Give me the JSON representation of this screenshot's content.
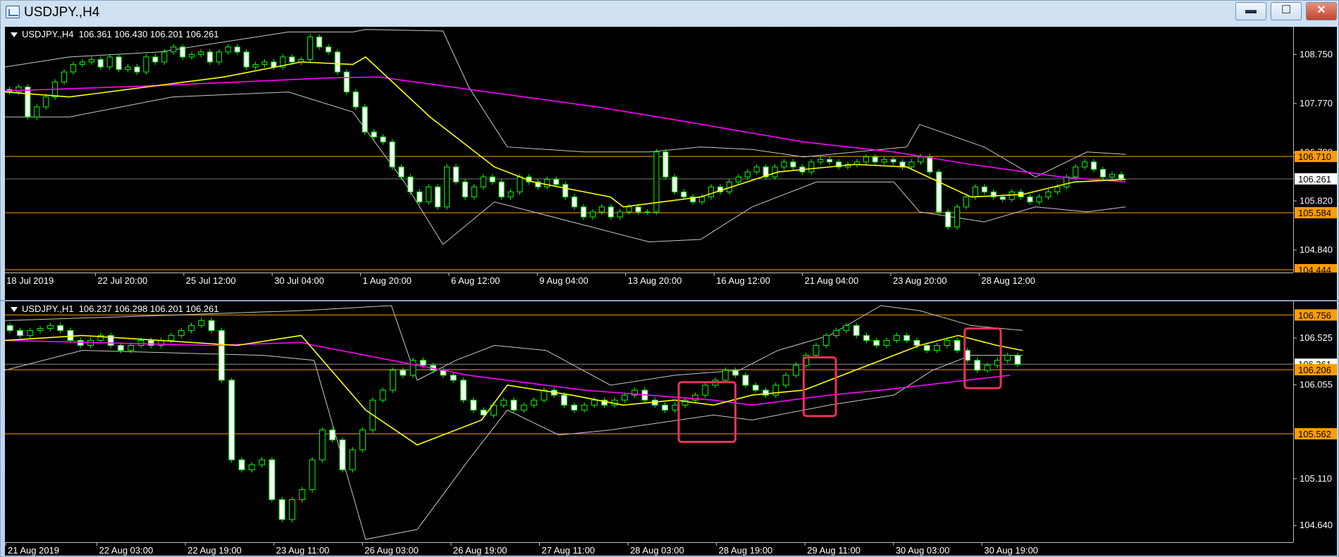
{
  "window": {
    "title": "USDJPY.,H4"
  },
  "controls": {
    "minimize": "▬",
    "maximize": "☐",
    "close": "✕"
  },
  "colors": {
    "background": "#000000",
    "bull": "#00ff00",
    "bear": "#ffffff",
    "ma_fast": "#ffff00",
    "ma_slow": "#ff00ff",
    "bands": "#c8c8c8",
    "level": "#ff9c00",
    "highlight": "#e8335a",
    "axis_text": "#ffffff"
  },
  "chart_data": [
    {
      "type": "candlestick",
      "name": "USDJPY.,H4",
      "info_symbol": "USDJPY.,H4",
      "info_ohlc": "106.361 106.430 106.201 106.261",
      "ylim": [
        104.444,
        109.22
      ],
      "y_ticks": [
        108.75,
        107.77,
        106.79,
        105.82,
        104.84
      ],
      "y_tick_labels": [
        "108.750",
        "107.770",
        "106.790",
        "105.820",
        "104.840"
      ],
      "x_tick_labels": [
        "18 Jul 2019",
        "22 Jul 20:00",
        "25 Jul 12:00",
        "30 Jul 04:00",
        "1 Aug 20:00",
        "6 Aug 12:00",
        "9 Aug 04:00",
        "13 Aug 20:00",
        "16 Aug 12:00",
        "21 Aug 04:00",
        "23 Aug 20:00",
        "28 Aug 12:00"
      ],
      "levels": [
        {
          "value": 106.71,
          "label": "106.710",
          "color": "#ff9c00",
          "style": "orange"
        },
        {
          "value": 106.261,
          "label": "106.261",
          "color": "#a0a0a0",
          "style": "price"
        },
        {
          "value": 105.584,
          "label": "105.584",
          "color": "#ff9c00",
          "style": "orange"
        },
        {
          "value": 104.444,
          "label": "104.444",
          "color": "#ff9c00",
          "style": "orange"
        }
      ],
      "close_path": [
        108.0,
        108.1,
        107.5,
        107.7,
        107.9,
        108.2,
        108.4,
        108.55,
        108.6,
        108.65,
        108.5,
        108.7,
        108.45,
        108.5,
        108.4,
        108.7,
        108.6,
        108.8,
        108.9,
        108.7,
        108.75,
        108.8,
        108.6,
        108.8,
        108.9,
        108.8,
        108.5,
        108.55,
        108.6,
        108.5,
        108.7,
        108.6,
        108.65,
        109.1,
        108.9,
        108.8,
        108.4,
        108.0,
        107.7,
        107.2,
        107.1,
        107.0,
        106.5,
        106.3,
        106.0,
        105.8,
        106.1,
        105.7,
        106.5,
        106.2,
        105.9,
        106.1,
        106.3,
        106.2,
        105.9,
        106.0,
        106.3,
        106.2,
        106.1,
        106.25,
        106.15,
        105.9,
        105.7,
        105.5,
        105.6,
        105.7,
        105.5,
        105.6,
        105.7,
        105.6,
        105.6,
        106.8,
        106.3,
        106.0,
        105.9,
        105.8,
        105.9,
        106.1,
        106.0,
        106.2,
        106.3,
        106.4,
        106.5,
        106.3,
        106.5,
        106.6,
        106.5,
        106.4,
        106.6,
        106.65,
        106.6,
        106.5,
        106.55,
        106.6,
        106.7,
        106.6,
        106.65,
        106.6,
        106.5,
        106.6,
        106.7,
        106.4,
        105.6,
        105.3,
        105.7,
        105.9,
        106.1,
        106.0,
        105.9,
        105.85,
        106.0,
        105.9,
        105.8,
        105.9,
        106.0,
        106.1,
        106.3,
        106.5,
        106.6,
        106.45,
        106.3,
        106.35,
        106.26
      ],
      "ma_slow_points": [
        [
          108.02,
          0
        ],
        [
          108.13,
          0.12
        ],
        [
          108.28,
          0.25
        ],
        [
          108.3,
          0.29
        ],
        [
          107.7,
          0.46
        ],
        [
          107.4,
          0.53
        ],
        [
          107.0,
          0.62
        ],
        [
          106.8,
          0.69
        ],
        [
          106.55,
          0.75
        ],
        [
          106.3,
          0.82
        ],
        [
          106.2,
          0.87
        ]
      ],
      "ma_fast_points": [
        [
          108.0,
          0
        ],
        [
          107.9,
          0.05
        ],
        [
          108.1,
          0.11
        ],
        [
          108.3,
          0.17
        ],
        [
          108.6,
          0.23
        ],
        [
          108.55,
          0.27
        ],
        [
          108.7,
          0.28
        ],
        [
          107.5,
          0.33
        ],
        [
          106.5,
          0.38
        ],
        [
          106.2,
          0.41
        ],
        [
          105.9,
          0.47
        ],
        [
          105.7,
          0.48
        ],
        [
          105.9,
          0.54
        ],
        [
          106.4,
          0.6
        ],
        [
          106.55,
          0.66
        ],
        [
          106.5,
          0.7
        ],
        [
          105.9,
          0.75
        ],
        [
          105.95,
          0.79
        ],
        [
          106.2,
          0.83
        ],
        [
          106.25,
          0.87
        ]
      ],
      "band_upper_points": [
        [
          108.5,
          0
        ],
        [
          108.7,
          0.05
        ],
        [
          108.8,
          0.12
        ],
        [
          109.2,
          0.22
        ],
        [
          109.2,
          0.27
        ],
        [
          109.25,
          0.28
        ],
        [
          109.22,
          0.34
        ],
        [
          108.1,
          0.36
        ],
        [
          106.9,
          0.39
        ],
        [
          106.8,
          0.45
        ],
        [
          106.8,
          0.5
        ],
        [
          106.9,
          0.54
        ],
        [
          106.85,
          0.58
        ],
        [
          106.7,
          0.62
        ],
        [
          106.9,
          0.7
        ],
        [
          107.35,
          0.71
        ],
        [
          106.9,
          0.76
        ],
        [
          106.3,
          0.8
        ],
        [
          106.8,
          0.84
        ],
        [
          106.75,
          0.87
        ]
      ],
      "band_lower_points": [
        [
          107.5,
          0
        ],
        [
          107.5,
          0.05
        ],
        [
          107.9,
          0.13
        ],
        [
          108.0,
          0.22
        ],
        [
          107.6,
          0.27
        ],
        [
          106.2,
          0.31
        ],
        [
          104.95,
          0.34
        ],
        [
          105.8,
          0.38
        ],
        [
          105.6,
          0.41
        ],
        [
          105.0,
          0.5
        ],
        [
          105.05,
          0.54
        ],
        [
          105.7,
          0.58
        ],
        [
          106.2,
          0.63
        ],
        [
          106.2,
          0.69
        ],
        [
          105.6,
          0.71
        ],
        [
          105.4,
          0.76
        ],
        [
          105.7,
          0.8
        ],
        [
          105.6,
          0.84
        ],
        [
          105.7,
          0.87
        ]
      ]
    },
    {
      "type": "candlestick",
      "name": "USDJPY.,H1",
      "info_symbol": "USDJPY.,H1",
      "info_ohlc": "106.237 106.298 106.201 106.261",
      "ylim": [
        104.5,
        106.85
      ],
      "y_ticks": [
        106.525,
        106.055,
        105.11,
        104.64
      ],
      "y_tick_labels": [
        "106.525",
        "106.055",
        "105.110",
        "104.640"
      ],
      "x_tick_labels": [
        "21 Aug 2019",
        "22 Aug 03:00",
        "22 Aug 19:00",
        "23 Aug 11:00",
        "26 Aug 03:00",
        "26 Aug 19:00",
        "27 Aug 11:00",
        "28 Aug 03:00",
        "28 Aug 19:00",
        "29 Aug 11:00",
        "30 Aug 03:00",
        "30 Aug 19:00"
      ],
      "levels": [
        {
          "value": 106.756,
          "label": "106.756",
          "color": "#ff9c00",
          "style": "orange"
        },
        {
          "value": 106.261,
          "label": "106.261",
          "color": "#a0a0a0",
          "style": "price"
        },
        {
          "value": 106.206,
          "label": "106.206",
          "color": "#ff9c00",
          "style": "orange"
        },
        {
          "value": 105.562,
          "label": "105.562",
          "color": "#ff9c00",
          "style": "orange"
        }
      ],
      "close_path": [
        106.6,
        106.55,
        106.6,
        106.62,
        106.65,
        106.6,
        106.5,
        106.45,
        106.5,
        106.55,
        106.45,
        106.4,
        106.45,
        106.5,
        106.45,
        106.5,
        106.55,
        106.6,
        106.65,
        106.7,
        106.6,
        106.1,
        105.3,
        105.2,
        105.25,
        105.3,
        104.9,
        104.7,
        104.9,
        105.0,
        105.3,
        105.6,
        105.5,
        105.2,
        105.4,
        105.6,
        105.9,
        106.0,
        106.2,
        106.15,
        106.3,
        106.25,
        106.2,
        106.15,
        106.1,
        105.9,
        105.8,
        105.75,
        105.85,
        105.9,
        105.8,
        105.85,
        105.9,
        106.0,
        105.95,
        105.85,
        105.8,
        105.85,
        105.9,
        105.85,
        105.9,
        105.95,
        106.0,
        105.9,
        105.85,
        105.8,
        105.85,
        105.9,
        105.95,
        106.05,
        106.1,
        106.2,
        106.15,
        106.05,
        106.0,
        105.95,
        106.05,
        106.15,
        106.25,
        106.35,
        106.45,
        106.55,
        106.6,
        106.65,
        106.55,
        106.5,
        106.45,
        106.5,
        106.55,
        106.5,
        106.45,
        106.4,
        106.45,
        106.5,
        106.4,
        106.3,
        106.2,
        106.25,
        106.3,
        106.35,
        106.26
      ],
      "ma_slow_points": [
        [
          106.5,
          0
        ],
        [
          106.45,
          0.16
        ],
        [
          106.48,
          0.23
        ],
        [
          106.45,
          0.24
        ],
        [
          106.15,
          0.36
        ],
        [
          106.0,
          0.45
        ],
        [
          105.9,
          0.55
        ],
        [
          105.85,
          0.58
        ],
        [
          105.9,
          0.61
        ],
        [
          105.95,
          0.64
        ],
        [
          106.0,
          0.68
        ],
        [
          106.15,
          0.78
        ]
      ],
      "ma_fast_points": [
        [
          106.5,
          0
        ],
        [
          106.55,
          0.06
        ],
        [
          106.5,
          0.12
        ],
        [
          106.45,
          0.18
        ],
        [
          106.55,
          0.23
        ],
        [
          105.8,
          0.28
        ],
        [
          105.45,
          0.32
        ],
        [
          105.7,
          0.37
        ],
        [
          106.05,
          0.39
        ],
        [
          105.95,
          0.44
        ],
        [
          105.85,
          0.48
        ],
        [
          105.9,
          0.52
        ],
        [
          105.85,
          0.55
        ],
        [
          105.95,
          0.58
        ],
        [
          106.0,
          0.62
        ],
        [
          106.2,
          0.66
        ],
        [
          106.45,
          0.71
        ],
        [
          106.55,
          0.74
        ],
        [
          106.45,
          0.77
        ],
        [
          106.4,
          0.79
        ]
      ],
      "band_upper_points": [
        [
          106.7,
          0
        ],
        [
          106.75,
          0.12
        ],
        [
          106.8,
          0.23
        ],
        [
          106.85,
          0.3
        ],
        [
          106.1,
          0.32
        ],
        [
          106.3,
          0.35
        ],
        [
          106.45,
          0.38
        ],
        [
          106.4,
          0.42
        ],
        [
          106.05,
          0.47
        ],
        [
          106.15,
          0.52
        ],
        [
          106.2,
          0.57
        ],
        [
          106.4,
          0.6
        ],
        [
          106.55,
          0.64
        ],
        [
          106.85,
          0.68
        ],
        [
          106.8,
          0.71
        ],
        [
          106.65,
          0.75
        ],
        [
          106.6,
          0.79
        ]
      ],
      "band_lower_points": [
        [
          106.2,
          0
        ],
        [
          106.4,
          0.06
        ],
        [
          106.35,
          0.2
        ],
        [
          106.3,
          0.24
        ],
        [
          105.4,
          0.26
        ],
        [
          104.5,
          0.28
        ],
        [
          104.6,
          0.32
        ],
        [
          105.3,
          0.36
        ],
        [
          105.8,
          0.39
        ],
        [
          105.55,
          0.43
        ],
        [
          105.6,
          0.47
        ],
        [
          105.75,
          0.55
        ],
        [
          105.7,
          0.58
        ],
        [
          105.85,
          0.64
        ],
        [
          105.95,
          0.69
        ],
        [
          106.2,
          0.72
        ],
        [
          106.35,
          0.75
        ],
        [
          106.35,
          0.79
        ]
      ],
      "highlights": [
        {
          "x0": 0.523,
          "x1": 0.567,
          "y_top": 106.08,
          "y_bottom": 105.48
        },
        {
          "x0": 0.62,
          "x1": 0.645,
          "y_top": 106.33,
          "y_bottom": 105.74
        },
        {
          "x0": 0.745,
          "x1": 0.773,
          "y_top": 106.62,
          "y_bottom": 106.02
        }
      ]
    }
  ]
}
